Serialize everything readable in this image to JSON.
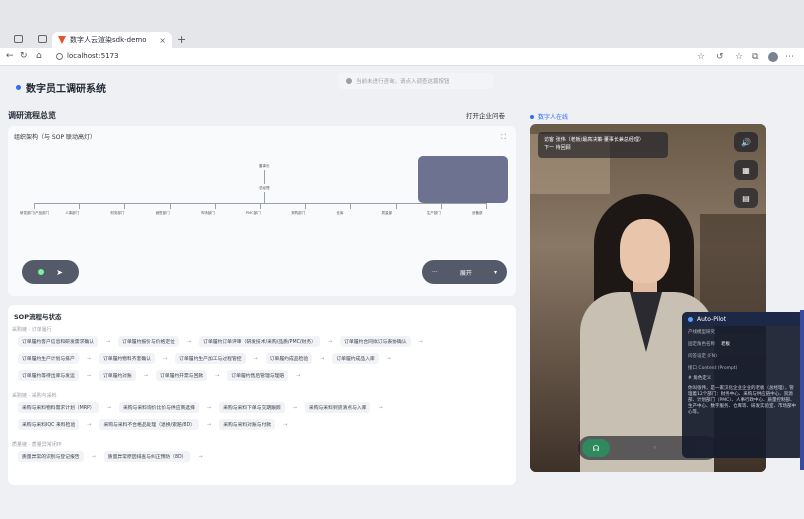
{
  "browser": {
    "tab_title": "数字人云渲染sdk-demo",
    "tab_close": "×",
    "new_tab": "+",
    "url": "localhost:5173"
  },
  "header": {
    "app_title": "数字员工调研系统",
    "notice": "当前未进行咨询，请点入调查这篇按钮"
  },
  "overview": {
    "title": "调研流程总览",
    "open_link": "打开企业问卷",
    "org_card_title": "组织架构（与 SOP 联动高灯）",
    "org_top": "董事长",
    "org_mid": "总经理",
    "org_nodes": [
      "研发部门/产品部门",
      "人事部门",
      "财务部门",
      "销售部门",
      "市场部门",
      "PMC部门",
      "采购部门",
      "仓库",
      "质量部",
      "生产部门",
      "设备部"
    ],
    "ctrl_right_label": "展开",
    "ctrl_chevron": "▾"
  },
  "sop": {
    "title": "SOP流程与状态",
    "groups": [
      {
        "name": "采购链 · 订单履行",
        "rows": [
          [
            "订单履约客户信息和研发需求确认",
            "订单履约报价与价格定位",
            "订单履约订单评审（研发技术/采购/品质/PMC/财务）",
            "订单履约合同拟订与表协确认"
          ],
          [
            "订单履约生产计划与排产",
            "订单履约物料齐套确认",
            "订单履约生产加工与过程管控",
            "订单履约成品检验",
            "订单履约成品入库"
          ],
          [
            "订单履约等待出库与发运",
            "订单履约对账",
            "订单履约开票与回款",
            "订单履约售后管理与理赔"
          ]
        ]
      },
      {
        "name": "采购链 · 采购与采料",
        "rows": [
          [
            "采购与采料物料需求计划（MRP）",
            "采购与采料询价比价与供应商选择",
            "采购与采料下单与交期跟踪",
            "采购与采料到货清点与入库"
          ],
          [
            "采购与采料IQC 来料检验",
            "采购与采料不合格品处理（退换/索赔/8D）",
            "采购与采料对账与付款"
          ]
        ]
      },
      {
        "name": "质量链 · 质量异常闭环",
        "rows": [
          [
            "质量异常的识别与登记报告",
            "质量异常原因排查与纠正预防（8D）"
          ]
        ]
      }
    ]
  },
  "digital_human": {
    "section_label": "数字人在线",
    "caption_line1": "访客  张伟（老板/最高决策·董事长兼总经理）",
    "caption_line2": "下一  待回顾",
    "buttons": [
      "speaker-icon",
      "calendar-icon",
      "document-icon"
    ]
  },
  "autopilot": {
    "title": "Auto-Pilot",
    "rows": [
      {
        "k": "产线模型研究",
        "v": ""
      },
      {
        "k": "固定角色名称",
        "v": "老板"
      },
      {
        "k": "问答设定 (FN)",
        "v": ""
      },
      {
        "k": "接口 Content (Prompt)",
        "v": ""
      }
    ],
    "def_title": "# 角色定义",
    "def_text": "你叫张伟，是一家汉化企业企业的老板（总经理），管理着12个部门：财务中心、采购与供应链中心、资源部、计划部门（PMC）、人事行政中心、质量控制部、生产中心、数字服务、仓库等、研发实验室、市场部中心等。"
  },
  "colors": {
    "accent": "#2f6bff",
    "org_box": "#6e7291",
    "control_pill": "#545a6a",
    "call_green": "#2e8a5c"
  }
}
